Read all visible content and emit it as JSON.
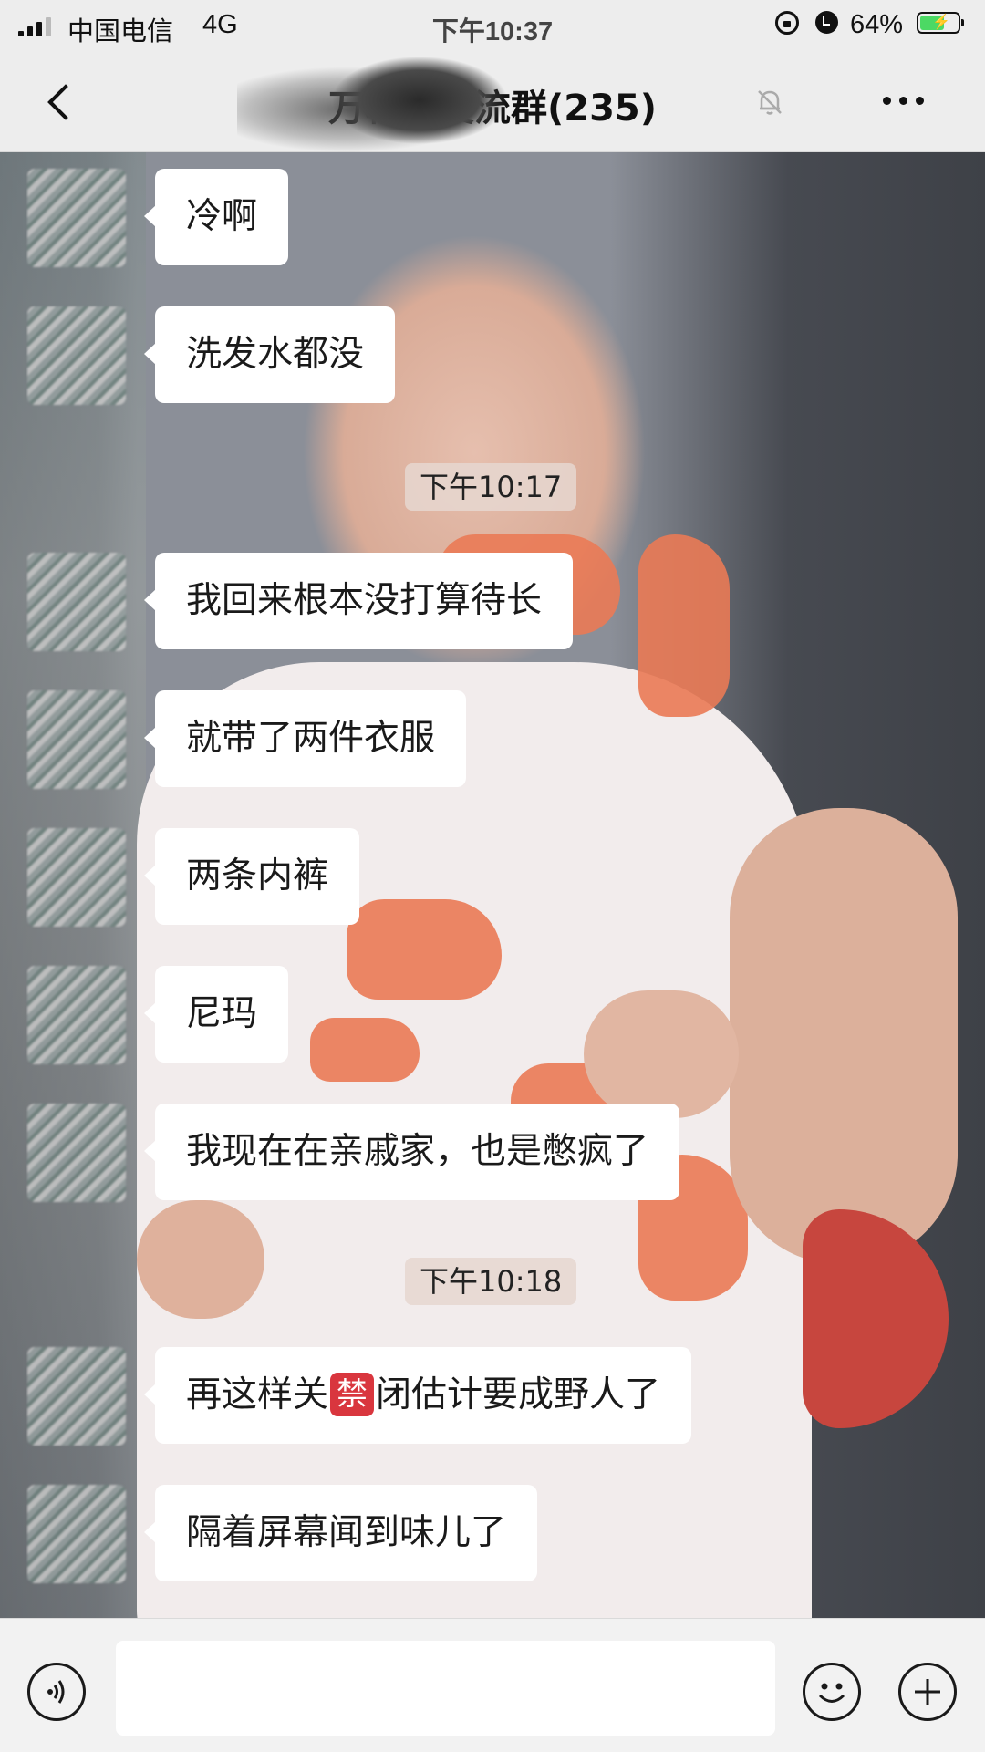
{
  "status_bar": {
    "carrier": "中国电信",
    "network": "4G",
    "time": "下午10:37",
    "battery_percent": "64%",
    "battery_level": 0.64
  },
  "nav": {
    "title": "万科…交流群(235)",
    "back_icon": "chevron-left-icon",
    "mute_icon": "bell-off-icon",
    "more_icon": "more-dots-icon"
  },
  "messages": [
    {
      "type": "text",
      "text": "冷啊"
    },
    {
      "type": "text",
      "text": "洗发水都没"
    },
    {
      "type": "time",
      "text": "下午10:17"
    },
    {
      "type": "text",
      "text": "我回来根本没打算待长"
    },
    {
      "type": "text",
      "text": "就带了两件衣服"
    },
    {
      "type": "text",
      "text": "两条内裤"
    },
    {
      "type": "text",
      "text": "尼玛"
    },
    {
      "type": "text",
      "text": "我现在在亲戚家，也是憋疯了"
    },
    {
      "type": "time",
      "text": "下午10:18"
    },
    {
      "type": "text",
      "text_before": "再这样关",
      "emoji": "禁",
      "text_after": "闭估计要成野人了"
    },
    {
      "type": "text",
      "text": "隔着屏幕闻到味儿了"
    }
  ],
  "input_bar": {
    "voice_icon": "voice-icon",
    "input_value": "",
    "emoji_icon": "smiley-icon",
    "plus_icon": "plus-icon"
  },
  "colors": {
    "bar_bg": "#ededed",
    "bubble_bg": "#ffffff",
    "battery_fill": "#4cd964",
    "ban_emoji": "#d9363e"
  }
}
